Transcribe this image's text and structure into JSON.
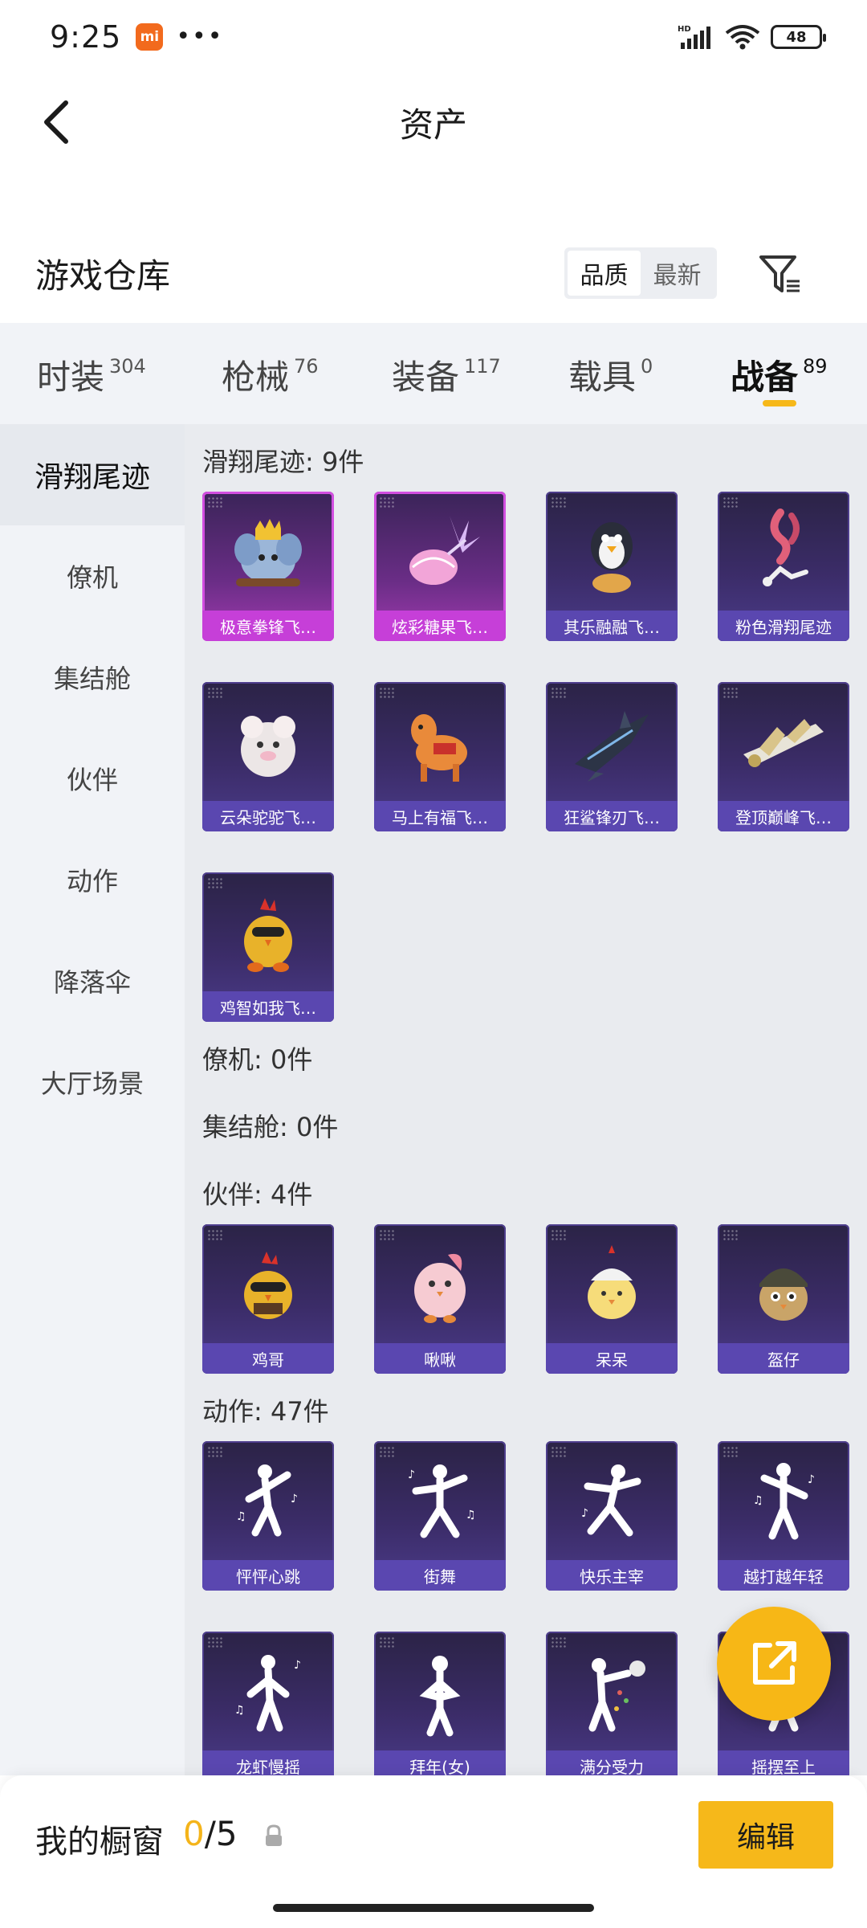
{
  "status_bar": {
    "time": "9:25",
    "app_badge": "mi",
    "more": "•••",
    "network": "HD",
    "battery": "48"
  },
  "nav": {
    "title": "资产"
  },
  "warehouse": {
    "title": "游戏仓库",
    "sort_options": [
      "品质",
      "最新"
    ],
    "sort_selected": "品质"
  },
  "category_tabs": [
    {
      "label": "时装",
      "count": "304"
    },
    {
      "label": "枪械",
      "count": "76"
    },
    {
      "label": "装备",
      "count": "117"
    },
    {
      "label": "载具",
      "count": "0"
    },
    {
      "label": "战备",
      "count": "89"
    }
  ],
  "active_tab": "战备",
  "sidebar": {
    "items": [
      "滑翔尾迹",
      "僚机",
      "集结舱",
      "伙伴",
      "动作",
      "降落伞",
      "大厅场景"
    ],
    "active": "滑翔尾迹"
  },
  "sections": [
    {
      "title": "滑翔尾迹: 9件",
      "items": [
        {
          "label": "极意拳锋飞…",
          "art": "elephant-fighter-icon",
          "rarity": "pink"
        },
        {
          "label": "炫彩糖果飞…",
          "art": "candy-wand-icon",
          "rarity": "pink"
        },
        {
          "label": "其乐融融飞…",
          "art": "penguin-icon",
          "rarity": "purple"
        },
        {
          "label": "粉色滑翔尾迹",
          "art": "pink-smoke-icon",
          "rarity": "purple"
        },
        {
          "label": "云朵驼驼飞…",
          "art": "alpaca-icon",
          "rarity": "purple"
        },
        {
          "label": "马上有福飞…",
          "art": "horse-toy-icon",
          "rarity": "purple"
        },
        {
          "label": "狂鲨锋刃飞…",
          "art": "shark-jet-icon",
          "rarity": "purple"
        },
        {
          "label": "登顶巅峰飞…",
          "art": "jet-wings-icon",
          "rarity": "purple"
        },
        {
          "label": "鸡智如我飞…",
          "art": "chicken-icon",
          "rarity": "purple"
        }
      ]
    },
    {
      "title": "僚机: 0件",
      "items": []
    },
    {
      "title": "集结舱: 0件",
      "items": []
    },
    {
      "title": "伙伴: 4件",
      "items": [
        {
          "label": "鸡哥",
          "art": "chicken-sunglasses-icon",
          "rarity": "purple"
        },
        {
          "label": "啾啾",
          "art": "pink-bird-icon",
          "rarity": "purple"
        },
        {
          "label": "呆呆",
          "art": "yellow-chick-icon",
          "rarity": "purple"
        },
        {
          "label": "盔仔",
          "art": "helmet-chick-icon",
          "rarity": "purple"
        }
      ]
    },
    {
      "title": "动作: 47件",
      "items": [
        {
          "label": "怦怦心跳",
          "art": "dance-pose-icon",
          "rarity": "purple"
        },
        {
          "label": "街舞",
          "art": "dance-pose-icon",
          "rarity": "purple"
        },
        {
          "label": "快乐主宰",
          "art": "dance-pose-icon",
          "rarity": "purple"
        },
        {
          "label": "越打越年轻",
          "art": "dance-pose-icon",
          "rarity": "purple"
        },
        {
          "label": "龙虾慢摇",
          "art": "dance-pose-icon",
          "rarity": "purple"
        },
        {
          "label": "拜年(女)",
          "art": "dance-pose-icon",
          "rarity": "purple"
        },
        {
          "label": "满分受力",
          "art": "dance-pose-icon",
          "rarity": "purple"
        },
        {
          "label": "摇摆至上",
          "art": "dance-pose-icon",
          "rarity": "purple"
        }
      ]
    }
  ],
  "bottom_bar": {
    "label": "我的橱窗",
    "current": "0",
    "separator": "/",
    "total": "5",
    "edit_label": "编辑"
  },
  "colors": {
    "accent": "#f6b81a",
    "card_purple": "#5a47b0",
    "card_pink": "#c63fd8",
    "sidebar_bg": "#f1f3f7",
    "content_bg": "#e9ebef"
  }
}
